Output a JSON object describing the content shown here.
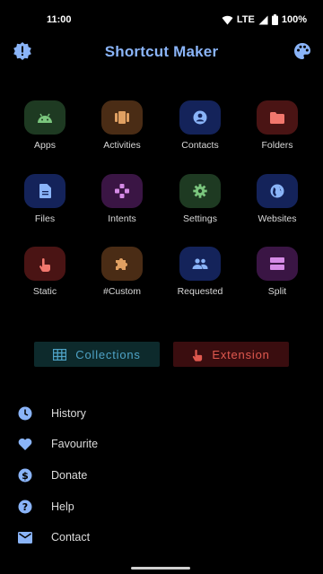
{
  "status_bar": {
    "time": "11:00",
    "network": "LTE",
    "battery": "100%"
  },
  "app_bar": {
    "title": "Shortcut Maker"
  },
  "grid": [
    {
      "label": "Apps",
      "icon": "android-icon",
      "bg": "#1e3a22",
      "fg": "#7bc67e"
    },
    {
      "label": "Activities",
      "icon": "activities-icon",
      "bg": "#4a2c15",
      "fg": "#e0a062"
    },
    {
      "label": "Contacts",
      "icon": "contact-icon",
      "bg": "#14235a",
      "fg": "#8ab4f8"
    },
    {
      "label": "Folders",
      "icon": "folder-icon",
      "bg": "#4a1414",
      "fg": "#f2776d"
    },
    {
      "label": "Files",
      "icon": "file-icon",
      "bg": "#14235a",
      "fg": "#8ab4f8"
    },
    {
      "label": "Intents",
      "icon": "intents-icon",
      "bg": "#3a1544",
      "fg": "#d58be6"
    },
    {
      "label": "Settings",
      "icon": "gear-icon",
      "bg": "#1e3a22",
      "fg": "#7bc67e"
    },
    {
      "label": "Websites",
      "icon": "globe-icon",
      "bg": "#14235a",
      "fg": "#8ab4f8"
    },
    {
      "label": "Static",
      "icon": "touch-icon",
      "bg": "#4a1414",
      "fg": "#f2776d"
    },
    {
      "label": "#Custom",
      "icon": "puzzle-icon",
      "bg": "#4a2c15",
      "fg": "#e0a062"
    },
    {
      "label": "Requested",
      "icon": "group-icon",
      "bg": "#14235a",
      "fg": "#8ab4f8"
    },
    {
      "label": "Split",
      "icon": "split-icon",
      "bg": "#3a1544",
      "fg": "#d58be6"
    }
  ],
  "chips": {
    "collections": "Collections",
    "extension": "Extension"
  },
  "menu": [
    {
      "label": "History",
      "icon": "clock-icon"
    },
    {
      "label": "Favourite",
      "icon": "heart-icon"
    },
    {
      "label": "Donate",
      "icon": "dollar-icon"
    },
    {
      "label": "Help",
      "icon": "help-icon"
    },
    {
      "label": "Contact",
      "icon": "mail-icon"
    }
  ],
  "colors": {
    "accent": "#8ab4f8",
    "collections": "#4fa3c7",
    "extension": "#e0594f",
    "background": "#000000"
  }
}
